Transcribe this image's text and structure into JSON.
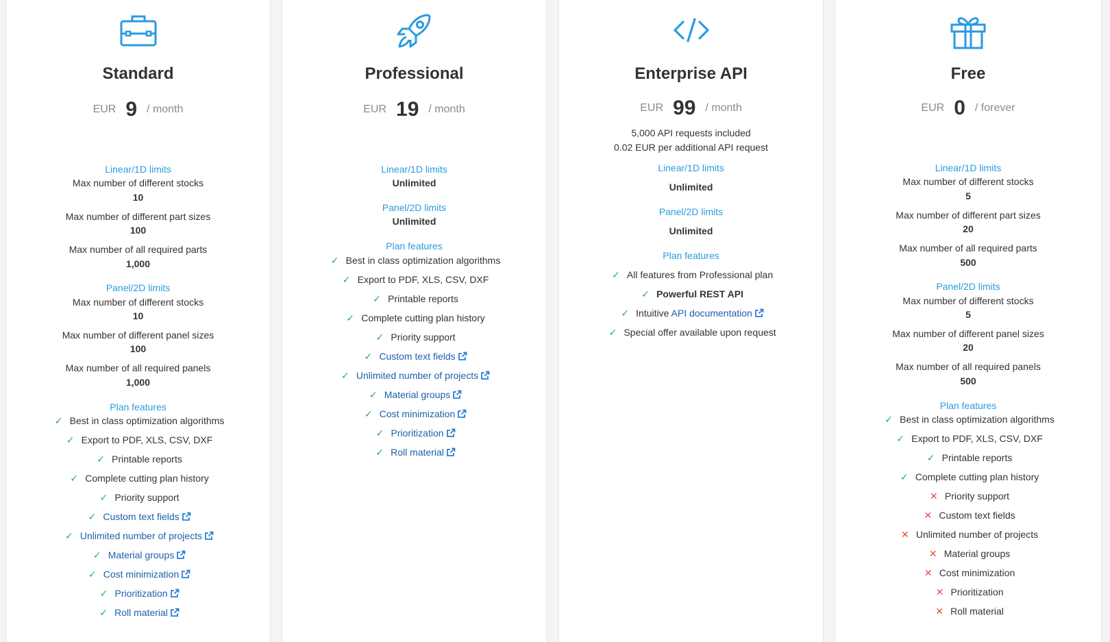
{
  "colors": {
    "accent": "#2a9be0",
    "check": "#2ea86b",
    "cross": "#e74c3c",
    "link": "#1d5fa8"
  },
  "plans": [
    {
      "icon": "briefcase-icon",
      "name": "Standard",
      "currency": "EUR",
      "amount": "9",
      "period": "/ month",
      "linear": {
        "title": "Linear/1D limits",
        "rows": [
          {
            "label": "Max number of different stocks",
            "value": "10"
          },
          {
            "label": "Max number of different part sizes",
            "value": "100"
          },
          {
            "label": "Max number of all required parts",
            "value": "1,000"
          }
        ]
      },
      "panel": {
        "title": "Panel/2D limits",
        "rows": [
          {
            "label": "Max number of different stocks",
            "value": "10"
          },
          {
            "label": "Max number of different panel sizes",
            "value": "100"
          },
          {
            "label": "Max number of all required panels",
            "value": "1,000"
          }
        ]
      },
      "features_title": "Plan features",
      "features": [
        "Best in class optimization algorithms",
        "Export to PDF, XLS, CSV, DXF",
        "Printable reports",
        "Complete cutting plan history",
        "Priority support",
        "Custom text fields",
        "Unlimited number of projects",
        "Material groups",
        "Cost minimization",
        "Prioritization",
        "Roll material"
      ]
    },
    {
      "icon": "rocket-icon",
      "name": "Professional",
      "currency": "EUR",
      "amount": "19",
      "period": "/ month",
      "linear": {
        "title": "Linear/1D limits",
        "value": "Unlimited"
      },
      "panel": {
        "title": "Panel/2D limits",
        "value": "Unlimited"
      },
      "features_title": "Plan features",
      "features": [
        "Best in class optimization algorithms",
        "Export to PDF, XLS, CSV, DXF",
        "Printable reports",
        "Complete cutting plan history",
        "Priority support",
        "Custom text fields",
        "Unlimited number of projects",
        "Material groups",
        "Cost minimization",
        "Prioritization",
        "Roll material"
      ]
    },
    {
      "icon": "code-icon",
      "name": "Enterprise API",
      "currency": "EUR",
      "amount": "99",
      "period": "/ month",
      "notes": [
        "5,000 API requests included",
        "0.02 EUR per additional API request"
      ],
      "linear": {
        "title": "Linear/1D limits",
        "value": "Unlimited"
      },
      "panel": {
        "title": "Panel/2D limits",
        "value": "Unlimited"
      },
      "features_title": "Plan features",
      "features": [
        "All features from Professional plan",
        "Powerful REST API",
        "Intuitive",
        "API documentation",
        "Special offer available upon request"
      ]
    },
    {
      "icon": "gift-icon",
      "name": "Free",
      "currency": "EUR",
      "amount": "0",
      "period": "/ forever",
      "linear": {
        "title": "Linear/1D limits",
        "rows": [
          {
            "label": "Max number of different stocks",
            "value": "5"
          },
          {
            "label": "Max number of different part sizes",
            "value": "20"
          },
          {
            "label": "Max number of all required parts",
            "value": "500"
          }
        ]
      },
      "panel": {
        "title": "Panel/2D limits",
        "rows": [
          {
            "label": "Max number of different stocks",
            "value": "5"
          },
          {
            "label": "Max number of different panel sizes",
            "value": "20"
          },
          {
            "label": "Max number of all required panels",
            "value": "500"
          }
        ]
      },
      "features_title": "Plan features",
      "features": [
        "Best in class optimization algorithms",
        "Export to PDF, XLS, CSV, DXF",
        "Printable reports",
        "Complete cutting plan history",
        "Priority support",
        "Custom text fields",
        "Unlimited number of projects",
        "Material groups",
        "Cost minimization",
        "Prioritization",
        "Roll material"
      ]
    }
  ]
}
